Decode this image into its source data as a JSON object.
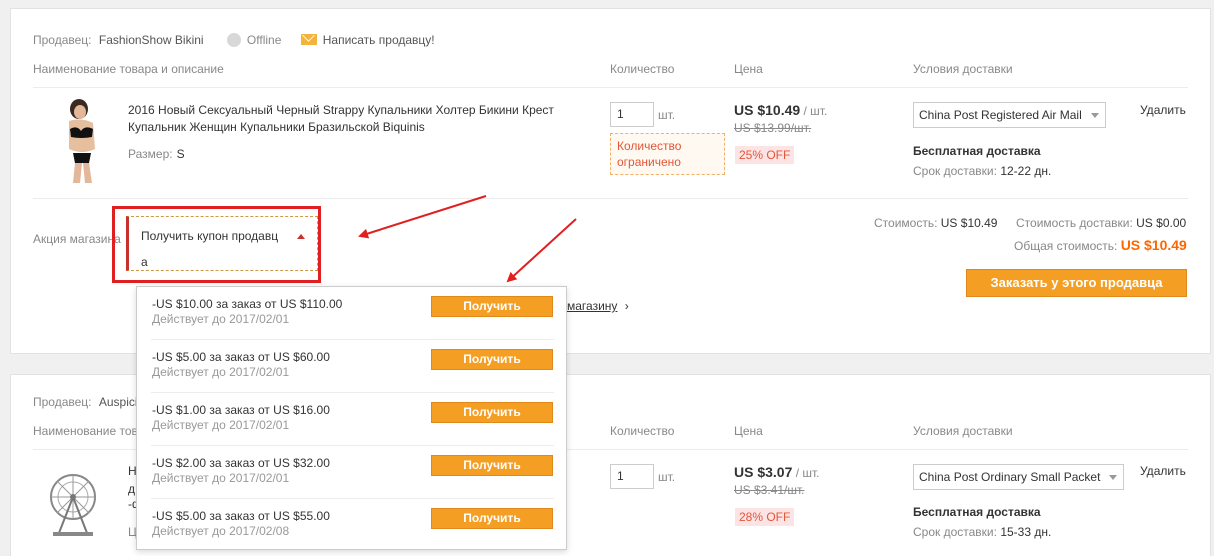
{
  "seller1": {
    "label": "Продавец:",
    "name": "FashionShow Bikini",
    "status": "Offline",
    "message_link": "Написать продавцу!"
  },
  "headers": {
    "product": "Наименование товара и описание",
    "quantity": "Количество",
    "price": "Цена",
    "shipping": "Условия доставки"
  },
  "item1": {
    "title": "2016 Новый Сексуальный Черный Strappy Купальники Холтер Бикини Крест Купальник Женщин Купальники Бразильской Biquinis",
    "size_label": "Размер:",
    "size_value": "S",
    "qty": "1",
    "qty_unit": "шт.",
    "limited": "Количество ограничено",
    "price": "US $10.49",
    "price_unit": "/ шт.",
    "old_price": "US $13.99/шт.",
    "discount": "25% OFF",
    "shipping_method": "China Post Registered Air Mail",
    "free_shipping": "Бесплатная доставка",
    "term_label": "Срок доставки:",
    "term_value": "12-22 дн.",
    "delete": "Удалить"
  },
  "promo": {
    "label": "Акция магазина",
    "coupon_trigger": "Получить купон продавц",
    "coupon_trigger_line2": "а",
    "store_link": "магазину"
  },
  "totals": {
    "cost_label": "Стоимость:",
    "cost_value": "US $10.49",
    "shipping_cost_label": "Стоимость доставки:",
    "shipping_cost_value": "US $0.00",
    "total_label": "Общая стоимость:",
    "total_value": "US $10.49",
    "order_button": "Заказать у этого продавца"
  },
  "coupons": [
    {
      "desc": "-US $10.00 за заказ от US $110.00",
      "valid": "Действует до 2017/02/01",
      "button": "Получить"
    },
    {
      "desc": "-US $5.00 за заказ от US $60.00",
      "valid": "Действует до 2017/02/01",
      "button": "Получить"
    },
    {
      "desc": "-US $1.00 за заказ от US $16.00",
      "valid": "Действует до 2017/02/01",
      "button": "Получить"
    },
    {
      "desc": "-US $2.00 за заказ от US $32.00",
      "valid": "Действует до 2017/02/01",
      "button": "Получить"
    },
    {
      "desc": "-US $5.00 за заказ от US $55.00",
      "valid": "Действует до 2017/02/08",
      "button": "Получить"
    }
  ],
  "seller2": {
    "label": "Продавец:",
    "name_visible": "Auspici",
    "header_product_visible": "Наименование тов"
  },
  "item2": {
    "title_fragments": [
      "Н",
      "д",
      "-ф"
    ],
    "size_fragment": "Ц",
    "qty": "1",
    "qty_unit": "шт.",
    "price": "US $3.07",
    "price_unit": "/ шт.",
    "old_price": "US $3.41/шт.",
    "discount": "28% OFF",
    "shipping_method": "China Post Ordinary Small Packet",
    "free_shipping": "Бесплатная доставка",
    "term_label": "Срок доставки:",
    "term_value": "15-33 дн.",
    "delete": "Удалить"
  },
  "colors": {
    "accent_orange": "#f59e24",
    "total_orange": "#ff6600",
    "annotation_red": "#e02020",
    "discount_bg": "#fde4e4"
  }
}
